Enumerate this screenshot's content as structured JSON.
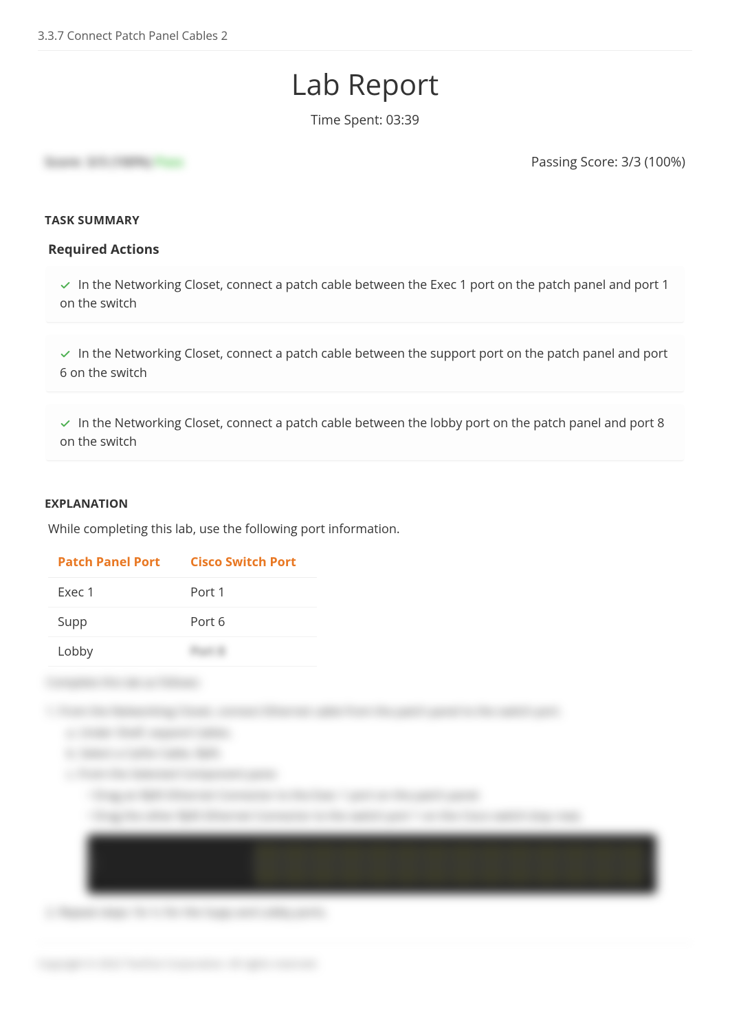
{
  "breadcrumb": "3.3.7 Connect Patch Panel Cables 2",
  "title": "Lab Report",
  "time_spent_label": "Time Spent: 03:39",
  "score_left_prefix": "Score: 3/3 (100%) ",
  "score_left_pass": "Pass",
  "passing_score": "Passing Score: 3/3 (100%)",
  "task_summary_header": "TASK SUMMARY",
  "required_actions_label": "Required Actions",
  "actions": [
    "In the Networking Closet, connect a patch cable between the Exec 1 port on the patch panel and port 1 on the switch",
    "In the Networking Closet, connect a patch cable between the support port on the patch panel and port 6 on the switch",
    "In the Networking Closet, connect a patch cable between the lobby port on the patch panel and port 8 on the switch"
  ],
  "explanation_header": "EXPLANATION",
  "explanation_intro": "While completing this lab, use the following port information.",
  "table": {
    "headers": [
      "Patch Panel Port",
      "Cisco Switch Port"
    ],
    "rows": [
      [
        "Exec 1",
        "Port 1"
      ],
      [
        "Supp",
        "Port 6"
      ],
      [
        "Lobby",
        "Port 8"
      ]
    ]
  },
  "blurred": {
    "line0": "Complete this lab as follows:",
    "line1": "1. From the Networking Closet, connect Ethernet cable from the patch panel to the switch port.",
    "line2": "a. Under Shelf, expand Cables.",
    "line3": "b. Select a Cat5e Cable, RJ45.",
    "line4": "c. From the Selected Component pane:",
    "line5": "• Drag an RJ45 Ethernet Connector to the Exec 1 port on the patch panel.",
    "line6": "• Drag the other RJ45 Ethernet Connector to the switch port 1 on the Cisco switch (top row).",
    "line7": "2. Repeat steps 1b-1c for the Supp and Lobby ports.",
    "footer": "Copyright © 2022 TestOut Corporation. All rights reserved."
  }
}
